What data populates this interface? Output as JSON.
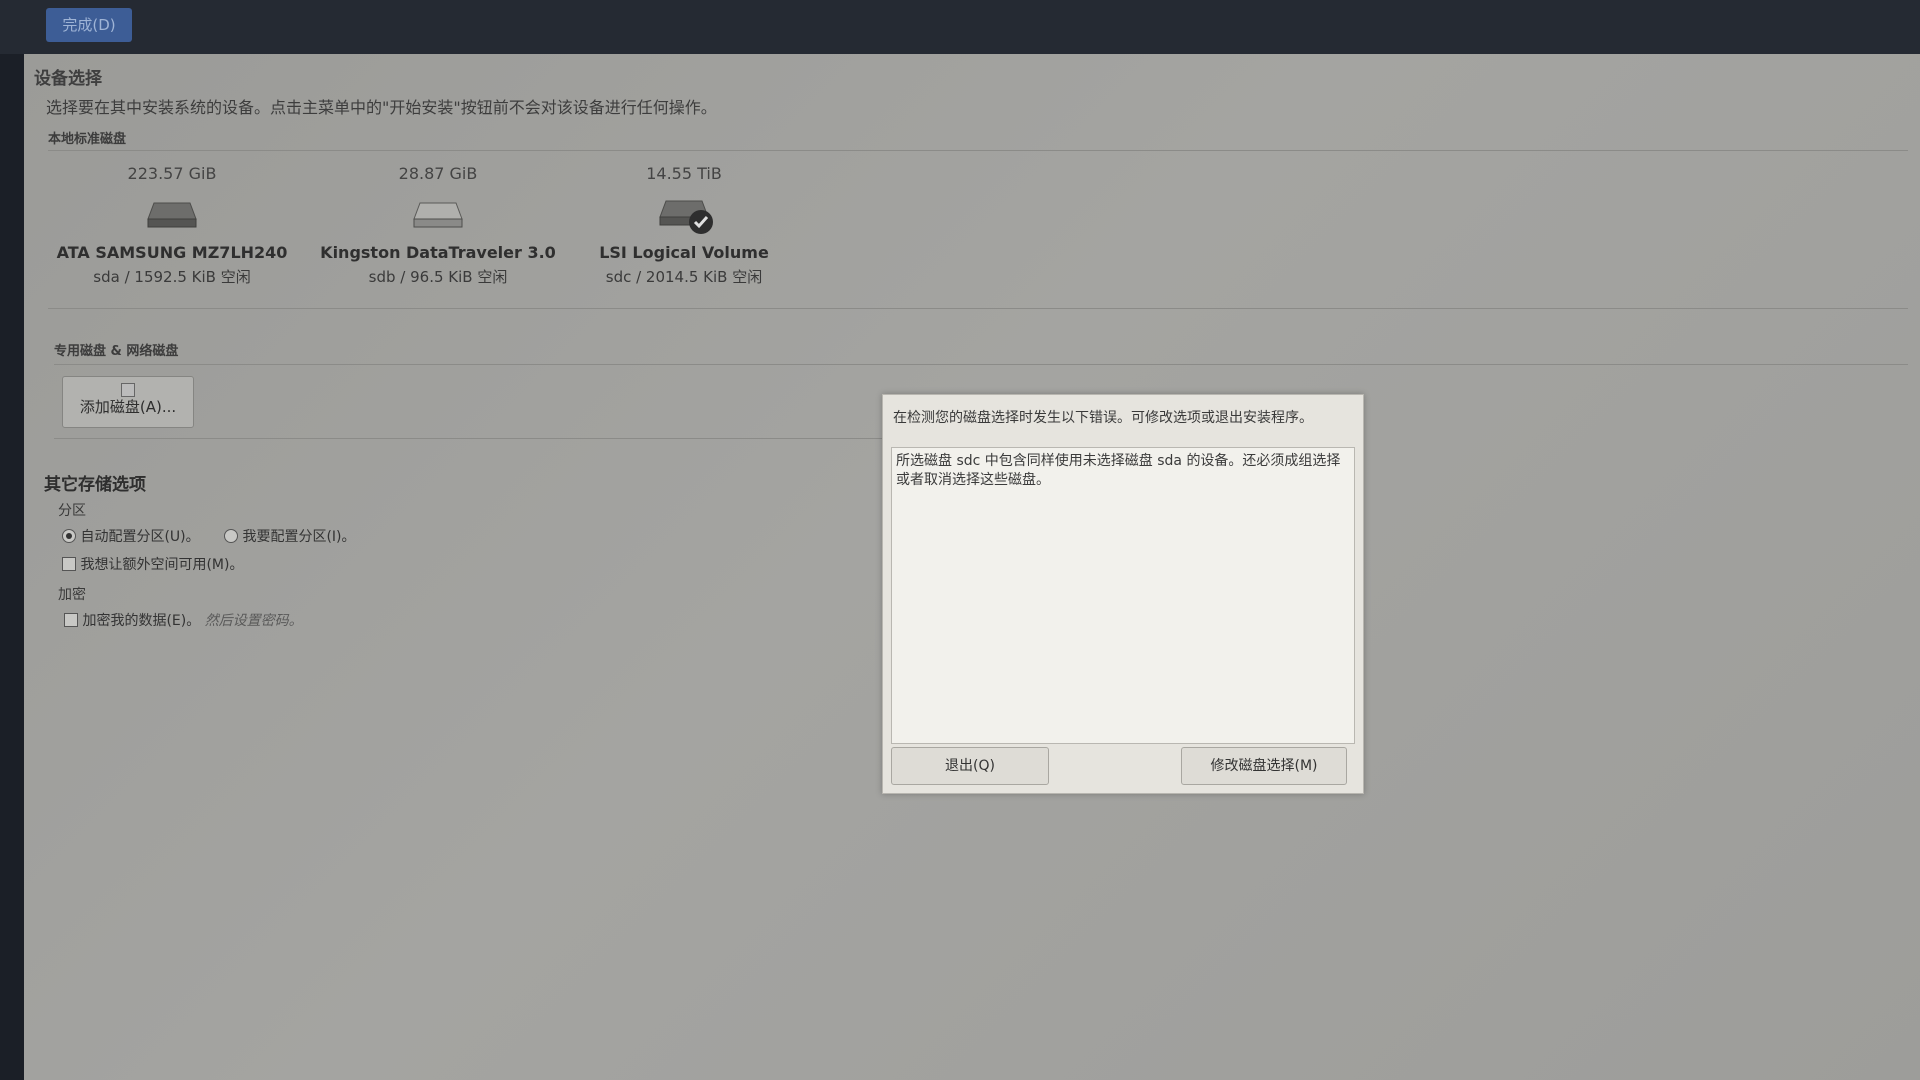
{
  "topbar": {
    "done_label": "完成(D)"
  },
  "page": {
    "title": "设备选择",
    "subtitle": "选择要在其中安装系统的设备。点击主菜单中的\"开始安装\"按钮前不会对该设备进行任何操作。"
  },
  "local_disks": {
    "heading": "本地标准磁盘",
    "disks": [
      {
        "size": "223.57 GiB",
        "name": "ATA SAMSUNG MZ7LH240",
        "info": "sda  /  1592.5 KiB 空闲",
        "selected": false
      },
      {
        "size": "28.87 GiB",
        "name": "Kingston DataTraveler 3.0",
        "info": "sdb  /  96.5 KiB 空闲",
        "selected": false
      },
      {
        "size": "14.55 TiB",
        "name": "LSI Logical Volume",
        "info": "sdc / 2014.5 KiB 空闲",
        "selected": true
      }
    ]
  },
  "special_disks": {
    "heading": "专用磁盘 & 网络磁盘",
    "add_button": "添加磁盘(A)..."
  },
  "other_storage": {
    "title": "其它存储选项",
    "partition_label": "分区",
    "auto_partition": "自动配置分区(U)。",
    "manual_partition": "我要配置分区(I)。",
    "extra_space": "我想让额外空间可用(M)。",
    "encryption_label": "加密",
    "encrypt_data": "加密我的数据(E)。",
    "encrypt_hint": "然后设置密码。"
  },
  "dialog": {
    "header": "在检测您的磁盘选择时发生以下错误。可修改选项或退出安装程序。",
    "message": "所选磁盘 sdc 中包含同样使用未选择磁盘 sda 的设备。还必须成组选择或者取消选择这些磁盘。",
    "quit_button": "退出(Q)",
    "modify_button": "修改磁盘选择(M)"
  }
}
